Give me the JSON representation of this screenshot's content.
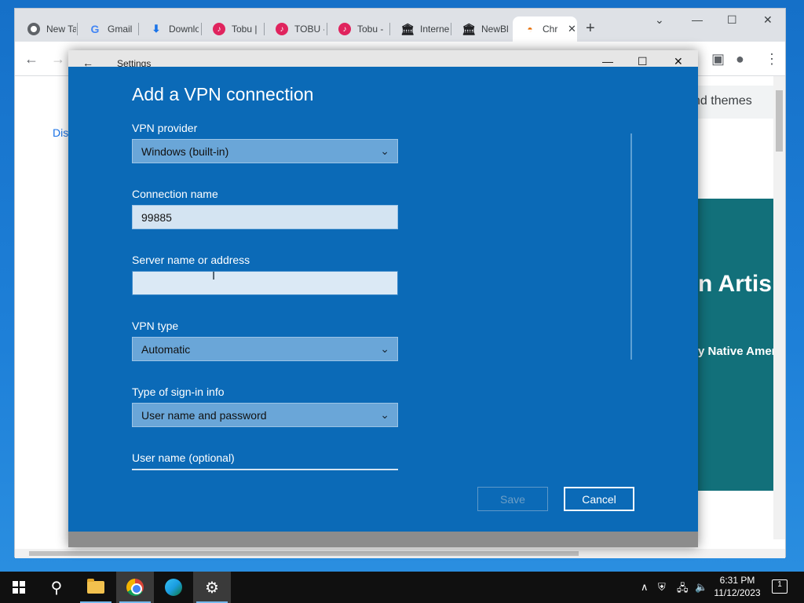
{
  "browser": {
    "tabs": [
      {
        "label": "New Ta",
        "icon": "chrome-icon"
      },
      {
        "label": "Gmail",
        "icon": "google-icon"
      },
      {
        "label": "Downlo",
        "icon": "download-icon"
      },
      {
        "label": "Tobu |",
        "icon": "music-icon"
      },
      {
        "label": "TOBU -",
        "icon": "music-icon"
      },
      {
        "label": "Tobu -",
        "icon": "music-icon"
      },
      {
        "label": "Interne",
        "icon": "archive-icon"
      },
      {
        "label": "NewBl",
        "icon": "archive-icon"
      },
      {
        "label": "Chr",
        "icon": "chrome-web-store-icon",
        "active": true
      }
    ],
    "themes_text": "nd themes",
    "left_text": "Dis",
    "banner_title": "n Artis",
    "banner_subtitle": "y Native Amer"
  },
  "settings_window": {
    "title": "Settings"
  },
  "vpn_form": {
    "heading": "Add a VPN connection",
    "provider_label": "VPN provider",
    "provider_value": "Windows (built-in)",
    "connection_name_label": "Connection name",
    "connection_name_value": "99885",
    "server_label": "Server name or address",
    "server_value": "",
    "vpn_type_label": "VPN type",
    "vpn_type_value": "Automatic",
    "signin_label": "Type of sign-in info",
    "signin_value": "User name and password",
    "username_label": "User name (optional)",
    "save_label": "Save",
    "cancel_label": "Cancel"
  },
  "taskbar": {
    "time": "6:31 PM",
    "date": "11/12/2023",
    "notification_count": "1"
  },
  "colors": {
    "vpn_panel": "#0b6ab7",
    "select_bg": "#6aa6d8",
    "input_bg": "#d4e4f2",
    "banner": "#12707a"
  }
}
